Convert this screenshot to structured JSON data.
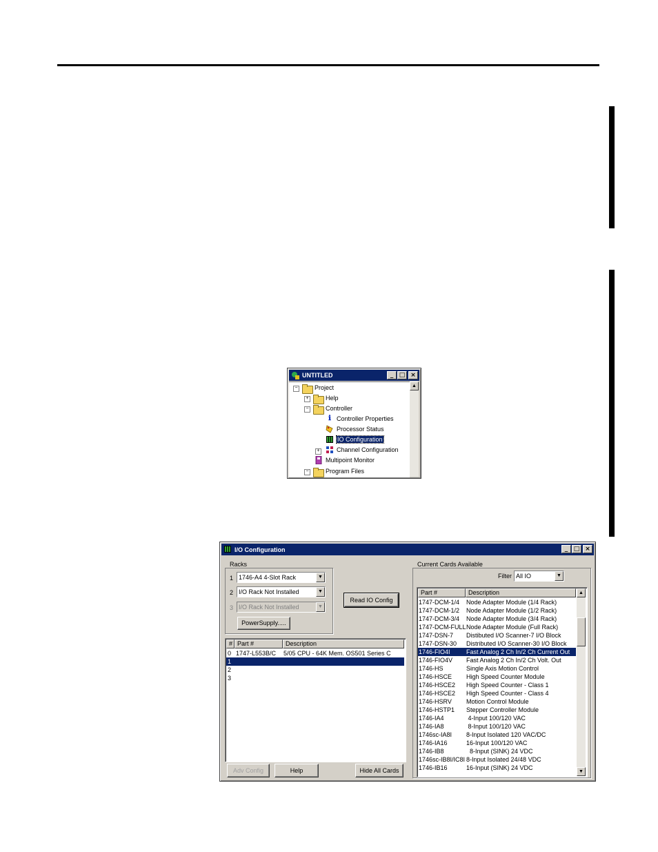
{
  "explorer": {
    "title": "UNTITLED",
    "buttons": {
      "minimize": "_",
      "maximize": "□",
      "close": "×"
    },
    "tree": [
      {
        "label": "Project",
        "toggle": "−"
      },
      {
        "label": "Help",
        "toggle": "+"
      },
      {
        "label": "Controller",
        "toggle": "−"
      },
      {
        "label": "Controller Properties"
      },
      {
        "label": "Processor Status"
      },
      {
        "label": "IO Configuration"
      },
      {
        "label": "Channel Configuration",
        "toggle": "+"
      },
      {
        "label": "Multipoint Monitor"
      },
      {
        "label": "Program Files",
        "toggle": "−"
      }
    ]
  },
  "io_config": {
    "title": "I/O Configuration",
    "racks": {
      "label": "Racks",
      "rows": [
        {
          "num": "1",
          "value": "1746-A4  4-Slot Rack",
          "enabled": true
        },
        {
          "num": "2",
          "value": "I/O Rack Not Installed",
          "enabled": true
        },
        {
          "num": "3",
          "value": "I/O Rack Not Installed",
          "enabled": false
        }
      ],
      "power_supply_button": "PowerSupply....."
    },
    "read_io_config_button": "Read IO Config",
    "slots": {
      "headers": {
        "num": "#",
        "part": "Part #",
        "desc": "Description"
      },
      "rows": [
        {
          "num": "0",
          "part": "1747-L553B/C",
          "desc": "5/05 CPU - 64K Mem. OS501 Series C"
        },
        {
          "num": "1",
          "part": "",
          "desc": ""
        },
        {
          "num": "2",
          "part": "",
          "desc": ""
        },
        {
          "num": "3",
          "part": "",
          "desc": ""
        }
      ],
      "selected_row": 1
    },
    "buttons": {
      "adv_config": "Adv Config",
      "help": "Help",
      "hide_all_cards": "Hide All Cards"
    },
    "cards": {
      "label": "Current Cards Available",
      "filter_label": "Filter",
      "filter_value": "All IO",
      "headers": {
        "part": "Part #",
        "desc": "Description"
      },
      "rows": [
        {
          "part": "1747-DCM-1/4",
          "desc": "Node Adapter Module (1/4 Rack)"
        },
        {
          "part": "1747-DCM-1/2",
          "desc": "Node Adapter Module (1/2 Rack)"
        },
        {
          "part": "1747-DCM-3/4",
          "desc": "Node Adapter Module (3/4 Rack)"
        },
        {
          "part": "1747-DCM-FULL",
          "desc": "Node Adapter Module (Full Rack)"
        },
        {
          "part": "1747-DSN-7",
          "desc": "Distibuted I/O Scanner-7 I/O Block"
        },
        {
          "part": "1747-DSN-30",
          "desc": "Distributed I/O Scanner-30 I/O Block"
        },
        {
          "part": "1746-FIO4I",
          "desc": "Fast Analog 2 Ch In/2 Ch Current Out"
        },
        {
          "part": "1746-FIO4V",
          "desc": "Fast Analog 2 Ch In/2 Ch Volt. Out"
        },
        {
          "part": "1746-HS",
          "desc": "Single Axis Motion Control"
        },
        {
          "part": "1746-HSCE",
          "desc": "High Speed Counter Module"
        },
        {
          "part": "1746-HSCE2",
          "desc": "High Speed Counter - Class 1"
        },
        {
          "part": "1746-HSCE2",
          "desc": "High Speed Counter - Class 4"
        },
        {
          "part": "1746-HSRV",
          "desc": "Motion Control Module"
        },
        {
          "part": "1746-HSTP1",
          "desc": "Stepper Controller Module"
        },
        {
          "part": "1746-IA4",
          "desc": " 4-Input 100/120 VAC"
        },
        {
          "part": "1746-IA8",
          "desc": " 8-Input 100/120 VAC"
        },
        {
          "part": "1746sc-IA8I",
          "desc": "8-Input Isolated 120 VAC/DC"
        },
        {
          "part": "1746-IA16",
          "desc": "16-Input 100/120 VAC"
        },
        {
          "part": "1746-IB8",
          "desc": "  8-Input (SINK) 24 VDC"
        },
        {
          "part": "1746sc-IB8I/IC8I",
          "desc": "8-Input Isolated 24/48 VDC"
        },
        {
          "part": "1746-IB16",
          "desc": "16-Input (SINK) 24 VDC"
        }
      ],
      "selected_row": 6
    }
  }
}
